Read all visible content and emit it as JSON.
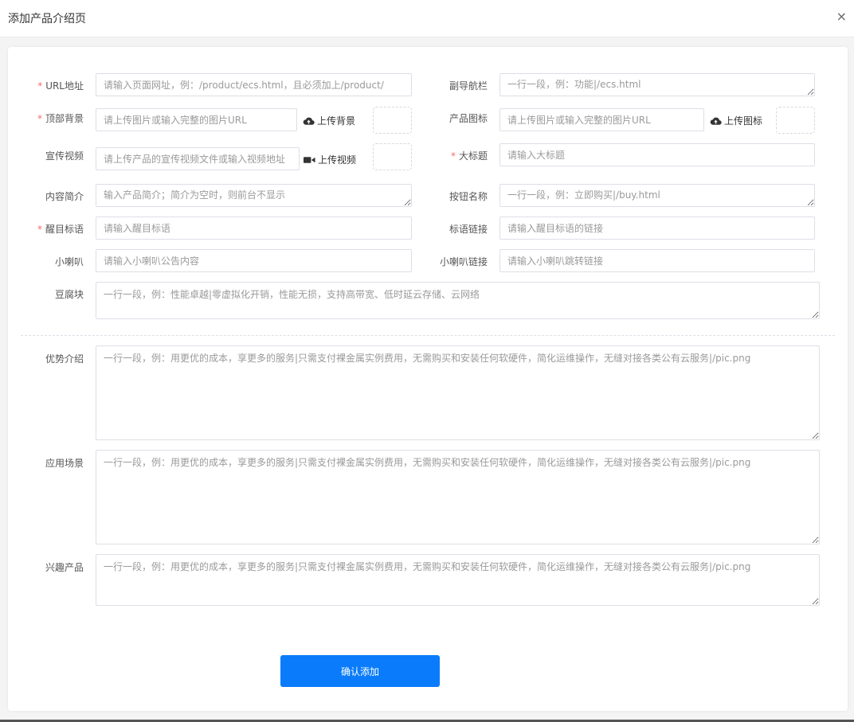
{
  "dialog": {
    "title": "添加产品介绍页",
    "close": "×"
  },
  "form": {
    "required_mark": "*",
    "url": {
      "label": "URL地址",
      "placeholder": "请输入页面网址，例：/product/ecs.html，且必须加上/product/"
    },
    "subnav": {
      "label": "副导航栏",
      "placeholder": "一行一段，例：功能|/ecs.html"
    },
    "top_bg": {
      "label": "顶部背景",
      "placeholder": "请上传图片或输入完整的图片URL",
      "upload": "上传背景"
    },
    "product_icon": {
      "label": "产品图标",
      "placeholder": "请上传图片或输入完整的图片URL",
      "upload": "上传图标"
    },
    "promo_video": {
      "label": "宣传视频",
      "placeholder": "请上传产品的宣传视频文件或输入视频地址",
      "upload": "上传视频"
    },
    "headline": {
      "label": "大标题",
      "placeholder": "请输入大标题"
    },
    "intro": {
      "label": "内容简介",
      "placeholder": "输入产品简介；简介为空时，则前台不显示"
    },
    "button_name": {
      "label": "按钮名称",
      "placeholder": "一行一段，例：立即购买|/buy.html"
    },
    "slogan": {
      "label": "醒目标语",
      "placeholder": "请输入醒目标语"
    },
    "slogan_link": {
      "label": "标语链接",
      "placeholder": "请输入醒目标语的链接"
    },
    "horn": {
      "label": "小喇叭",
      "placeholder": "请输入小喇叭公告内容"
    },
    "horn_link": {
      "label": "小喇叭链接",
      "placeholder": "请输入小喇叭跳转链接"
    },
    "tofu": {
      "label": "豆腐块",
      "placeholder": "一行一段，例：性能卓越|零虚拟化开销，性能无损，支持高带宽、低时延云存储、云网络"
    },
    "advantages": {
      "label": "优势介绍",
      "placeholder": "一行一段，例：用更优的成本，享更多的服务|只需支付裸金属实例费用，无需购买和安装任何软硬件，简化运维操作，无缝对接各类公有云服务|/pic.png"
    },
    "scenarios": {
      "label": "应用场景",
      "placeholder": "一行一段，例：用更优的成本，享更多的服务|只需支付裸金属实例费用，无需购买和安装任何软硬件，简化运维操作，无缝对接各类公有云服务|/pic.png"
    },
    "interests": {
      "label": "兴趣产品",
      "placeholder": "一行一段，例：用更优的成本，享更多的服务|只需支付裸金属实例费用，无需购买和安装任何软硬件，简化运维操作，无缝对接各类公有云服务|/pic.png"
    },
    "submit_label": "确认添加"
  }
}
